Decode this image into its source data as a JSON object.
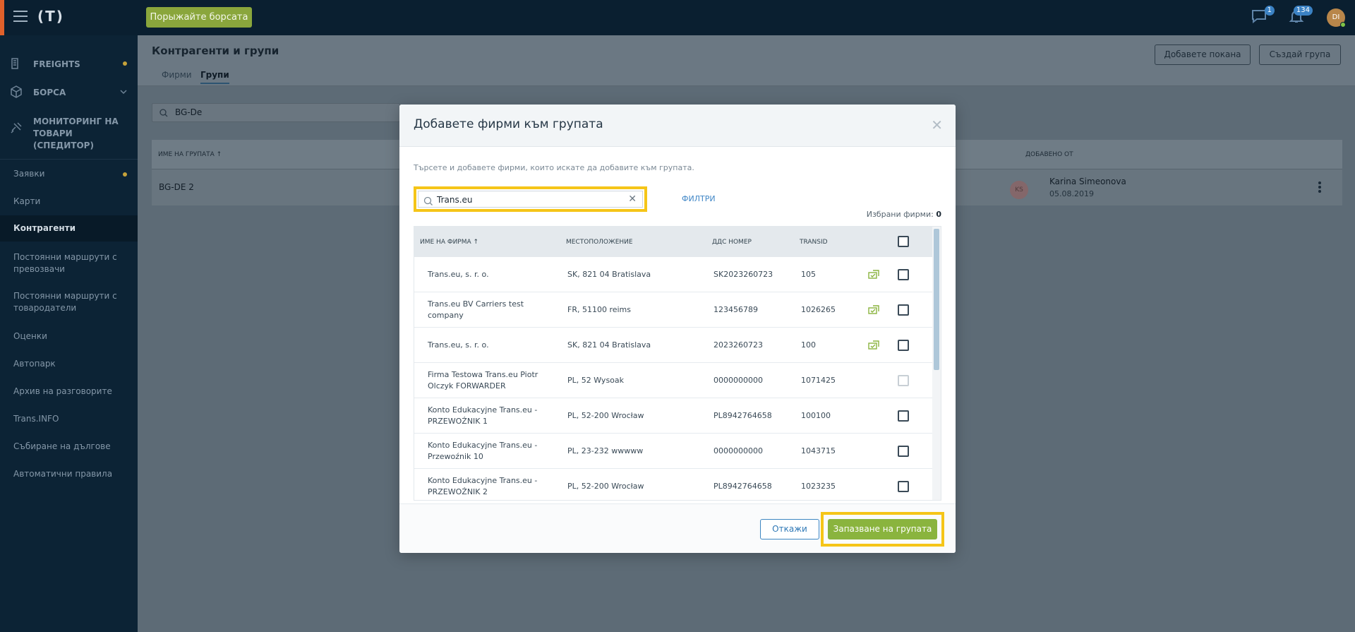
{
  "topbar": {
    "logo": "(T)",
    "market_button": "Порыжайте борсата",
    "messages_badge": "1",
    "notifications_badge": "134",
    "avatar_initials": "DI"
  },
  "sidebar": {
    "main_items": [
      {
        "label": "FREIGHTS",
        "icon": "freights-icon"
      },
      {
        "label": "БОРСА",
        "icon": "cube-icon"
      },
      {
        "label": "МОНИТОРИНГ НА ТОВАРИ (СПЕДИТОР)",
        "icon": "satellite-icon"
      }
    ],
    "items": [
      {
        "label": "Заявки"
      },
      {
        "label": "Карти"
      },
      {
        "label": "Контрагенти"
      },
      {
        "label": "Постоянни маршрути с превозвачи"
      },
      {
        "label": "Постоянни маршрути с товародатели"
      },
      {
        "label": "Оценки"
      },
      {
        "label": "Автопарк"
      },
      {
        "label": "Архив на разговорите"
      },
      {
        "label": "Trans.INFO"
      },
      {
        "label": "Събиране на дългове"
      },
      {
        "label": "Автоматични правила"
      }
    ]
  },
  "page": {
    "title": "Контрагенти и групи",
    "tabs": [
      "Фирми",
      "Групи"
    ],
    "invite_button": "Добавете покана",
    "create_group_button": "Създай група",
    "search_value": "BG-De",
    "table": {
      "col_name": "ИМЕ НА ГРУПАТА ↑",
      "col_added_by": "ДОБАВЕНО ОТ",
      "row_name": "BG-DE 2",
      "added_by_initials": "KS",
      "added_by_name": "Karina Simeonova",
      "added_date": "05.08.2019"
    }
  },
  "modal": {
    "title": "Добавете фирми към групата",
    "hint": "Търсете и добавете фирми, които искате да добавите към групата.",
    "search_value": "Trans.eu",
    "filters_label": "ФИЛТРИ",
    "selected_label": "Избрани фирми:",
    "selected_count": "0",
    "columns": [
      "ИМЕ НА ФИРМА ↑",
      "МЕСТОПОЛОЖЕНИЕ",
      "ДДС НОМЕР",
      "TRANSID"
    ],
    "rows": [
      {
        "name": "Trans.eu, s. r. o.",
        "location": "SK, 821 04 Bratislava",
        "vat": "SK2023260723",
        "transid": "105",
        "verified": true,
        "disabled": false
      },
      {
        "name": "Trans.eu BV Carriers test company",
        "location": "FR, 51100 reims",
        "vat": "123456789",
        "transid": "1026265",
        "verified": true,
        "disabled": false
      },
      {
        "name": "Trans.eu, s. r. o.",
        "location": "SK, 821 04 Bratislava",
        "vat": "2023260723",
        "transid": "100",
        "verified": true,
        "disabled": false
      },
      {
        "name": "Firma Testowa Trans.eu Piotr Olczyk FORWARDER",
        "location": "PL, 52 Wysoak",
        "vat": "0000000000",
        "transid": "1071425",
        "verified": false,
        "disabled": true
      },
      {
        "name": "Konto Edukacyjne Trans.eu - PRZEWOŹNIK 1",
        "location": "PL, 52-200 Wrocław",
        "vat": "PL8942764658",
        "transid": "100100",
        "verified": false,
        "disabled": false
      },
      {
        "name": "Konto Edukacyjne Trans.eu - Przewoźnik 10",
        "location": "PL, 23-232 wwwww",
        "vat": "0000000000",
        "transid": "1043715",
        "verified": false,
        "disabled": false
      },
      {
        "name": "Konto Edukacyjne Trans.eu - PRZEWOŹNIK 2",
        "location": "PL, 52-200 Wrocław",
        "vat": "PL8942764658",
        "transid": "1023235",
        "verified": false,
        "disabled": false
      }
    ],
    "cancel_button": "Откажи",
    "save_button": "Запазване на групата"
  }
}
